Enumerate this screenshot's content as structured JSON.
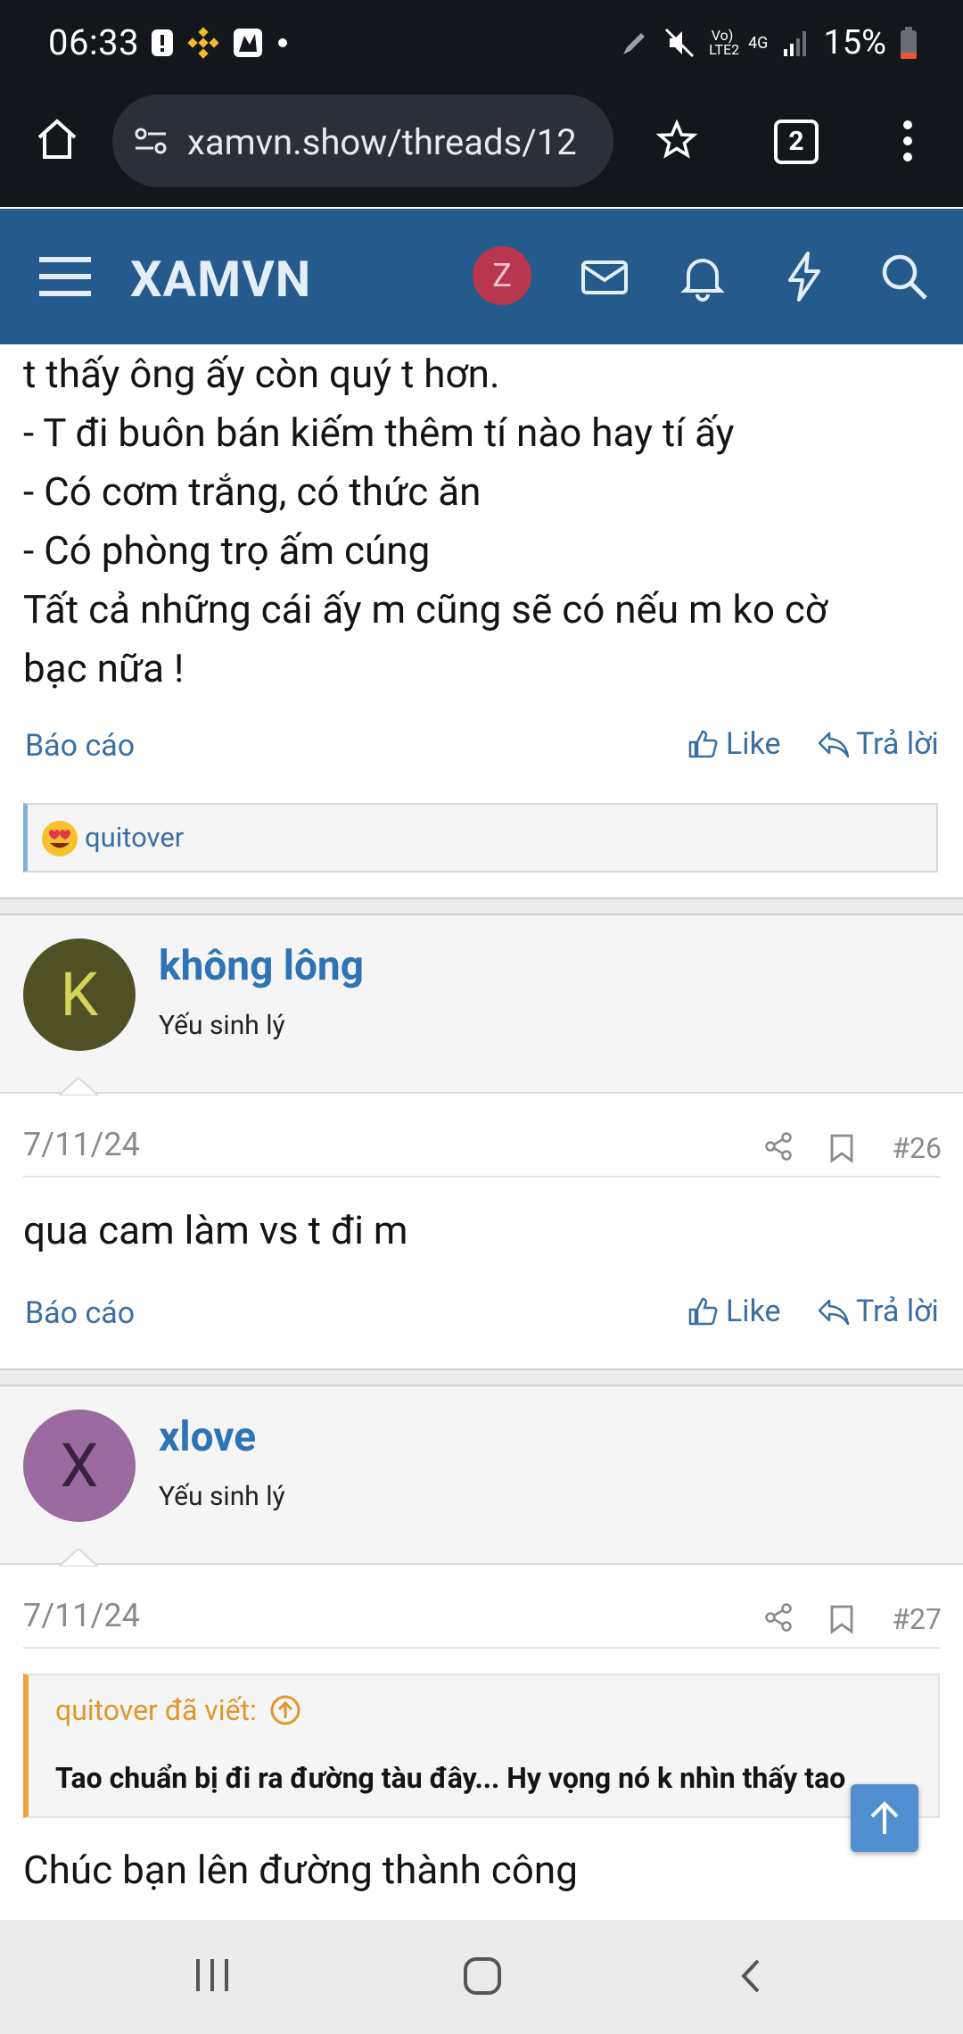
{
  "status_bar": {
    "time": "06:33",
    "net_label": "Vo) LTE2",
    "net_type": "4G",
    "battery": "15%"
  },
  "browser": {
    "url": "xamvn.show/threads/12",
    "tab_count": "2"
  },
  "site": {
    "logo": "XAMVN",
    "user_initial": "Z"
  },
  "top_post": {
    "lines": [
      "t thấy ông ấy còn quý t hơn.",
      "- T đi buôn bán kiếm thêm tí nào hay tí ấy",
      "- Có cơm trắng, có thức ăn",
      "- Có phòng trọ ấm cúng",
      "Tất cả những cái ấy m cũng sẽ có nếu m ko cờ",
      "bạc nữa !"
    ],
    "report": "Báo cáo",
    "like": "Like",
    "reply": "Trả lời",
    "reaction_user": "quitover"
  },
  "post_26": {
    "avatar_letter": "K",
    "username": "không lông",
    "user_title": "Yếu sinh lý",
    "date": "7/11/24",
    "number": "#26",
    "body": "qua cam làm vs t đi m",
    "report": "Báo cáo",
    "like": "Like",
    "reply": "Trả lời"
  },
  "post_27": {
    "avatar_letter": "X",
    "username": "xlove",
    "user_title": "Yếu sinh lý",
    "date": "7/11/24",
    "number": "#27",
    "quote_author": "quitover đã viết:",
    "quote_text": "Tao chuẩn bị đi ra đường tàu đây... Hy vọng nó k nhìn thấy tao",
    "body": "Chúc bạn lên đường thành công"
  },
  "colors": {
    "header_bg": "#255a8c",
    "link": "#3a6fa3",
    "username": "#2e74b5",
    "quote_accent": "#f0a33a"
  }
}
